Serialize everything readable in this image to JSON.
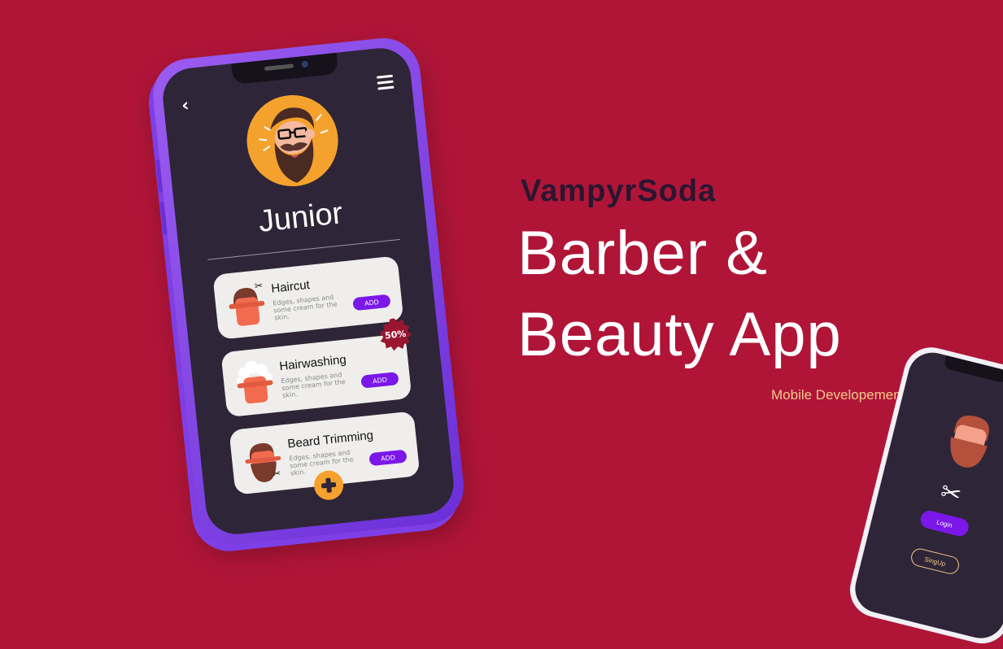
{
  "colors": {
    "background": "#b01538",
    "phone_frame": "#7e3fe6",
    "screen": "#2e2538",
    "accent_orange": "#f5a12e",
    "accent_purple": "#7b17e8",
    "card": "#efeeec",
    "badge": "#9a1630",
    "subtitle": "#f2c98a"
  },
  "hero": {
    "brand": "VampyrSoda",
    "headline_line1": "Barber &",
    "headline_line2": "Beauty App",
    "subtitle": "Mobile Developement"
  },
  "phone": {
    "back_icon": "chevron-left-icon",
    "menu_icon": "hamburger-menu-icon",
    "user_name": "Junior",
    "services": [
      {
        "title": "Haircut",
        "description": "Edges, shapes and some cream for the skin.",
        "button": "ADD",
        "icon": "scissors-icon"
      },
      {
        "title": "Hairwashing",
        "description": "Edges, shapes and some cream for the skin.",
        "button": "ADD",
        "badge": "50%"
      },
      {
        "title": "Beard Trimming",
        "description": "Edges, shapes and some cream for the skin.",
        "button": "ADD",
        "icon": "scissors-icon"
      }
    ],
    "fab_icon": "plus-icon"
  },
  "phone2": {
    "login_label": "Login",
    "signup_label": "SingUp",
    "icon": "scissors-icon"
  }
}
